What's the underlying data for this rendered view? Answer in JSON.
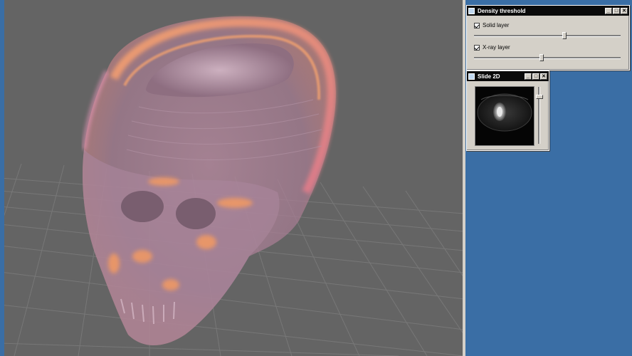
{
  "density_window": {
    "title": "Density threshold",
    "solid_layer": {
      "label": "Solid layer",
      "checked": true,
      "slider_value": 0.62
    },
    "xray_layer": {
      "label": "X-ray layer",
      "checked": true,
      "slider_value": 0.46
    },
    "buttons": {
      "minimize": "_",
      "maximize": "□",
      "close": "✕"
    }
  },
  "slide_window": {
    "title": "Slide 2D",
    "slice_slider_value": 0.15,
    "buttons": {
      "minimize": "_",
      "maximize": "□",
      "close": "✕"
    }
  },
  "colors": {
    "viewport_bg": "#646464",
    "desktop_bg": "#3a6ea5",
    "window_bg": "#d4d0c8",
    "titlebar_bg": "#0a0a0a",
    "xray_glow": "#f3a06a",
    "skull_surface": "#c9a3b4"
  }
}
